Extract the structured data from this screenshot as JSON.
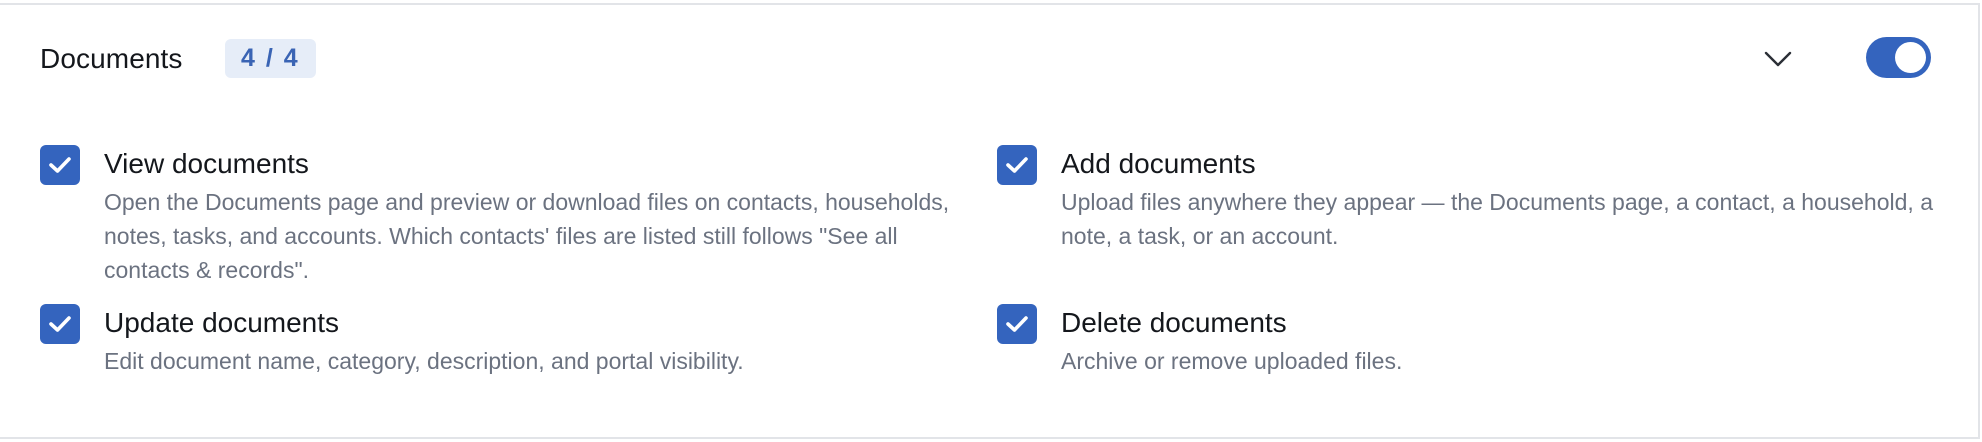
{
  "section": {
    "title": "Documents",
    "count_badge": "4 / 4",
    "expand_icon": "chevron-down-icon",
    "enabled": true,
    "accent_color": "#3464be"
  },
  "permissions": [
    {
      "label": "View documents",
      "description": "Open the Documents page and preview or download files on contacts, households, notes, tasks, and accounts. Which contacts' files are listed still follows \"See all contacts & records\".",
      "checked": true
    },
    {
      "label": "Add documents",
      "description": "Upload files anywhere they appear — the Documents page, a contact, a household, a note, a task, or an account.",
      "checked": true
    },
    {
      "label": "Update documents",
      "description": "Edit document name, category, description, and portal visibility.",
      "checked": true
    },
    {
      "label": "Delete documents",
      "description": "Archive or remove uploaded files.",
      "checked": true
    }
  ]
}
